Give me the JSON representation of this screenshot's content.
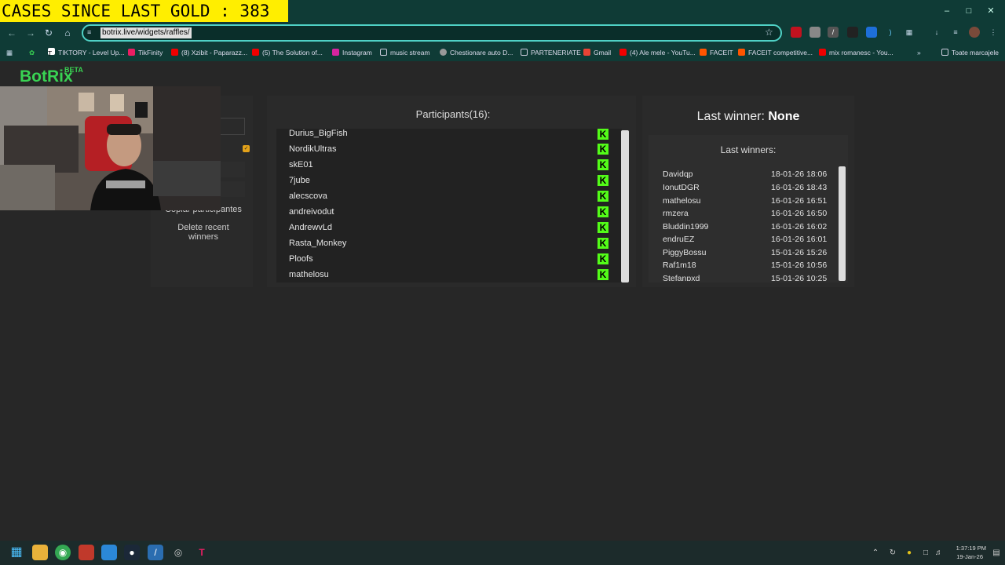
{
  "overlay": {
    "banner": "CASES SINCE LAST GOLD : 383"
  },
  "browser": {
    "url": "botrix.live/widgets/raffles/",
    "bookmarks": [
      "TIKTORY - Level Up...",
      "TikFinity",
      "(8) Xzibit - Paparazz...",
      "(5) The Solution of...",
      "Instagram",
      "music stream",
      "Chestionare auto D...",
      "PARTENERIATE",
      "Gmail",
      "(4) Ale mele - YouTu...",
      "FACEIT",
      "FACEIT competitive...",
      "mix romanesc - You...",
      "Toate marcajele"
    ]
  },
  "app": {
    "logo": "BotRix",
    "logo_badge": "BETA",
    "left_panel": {
      "copy_button": "Copiar participantes",
      "delete_button": "Delete recent winners"
    },
    "participants": {
      "title": "Participants(16):",
      "items": [
        "Durius_BigFish",
        "NordikUltras",
        "skE01",
        "7jube",
        "alecscova",
        "andreivodut",
        "AndrewvLd",
        "Rasta_Monkey",
        "Ploofs",
        "mathelosu"
      ]
    },
    "winner": {
      "label": "Last winner:",
      "value": "None",
      "history_title": "Last winners:",
      "history": [
        {
          "name": "Davidqp",
          "date": "18-01-26 18:06"
        },
        {
          "name": "IonutDGR",
          "date": "16-01-26 18:43"
        },
        {
          "name": "mathelosu",
          "date": "16-01-26 16:51"
        },
        {
          "name": "rmzera",
          "date": "16-01-26 16:50"
        },
        {
          "name": "Bluddin1999",
          "date": "16-01-26 16:02"
        },
        {
          "name": "endruEZ",
          "date": "16-01-26 16:01"
        },
        {
          "name": "PiggyBossu",
          "date": "15-01-26 15:26"
        },
        {
          "name": "Raf1m18",
          "date": "15-01-26 10:56"
        },
        {
          "name": "Stefanpxd",
          "date": "15-01-26 10:25"
        }
      ]
    }
  },
  "taskbar": {
    "time": "1:37:19 PM",
    "date": "19-Jan-26"
  },
  "colors": {
    "accent": "#39d353",
    "kick": "#53fc18",
    "chrome": "#0f3b36",
    "banner": "#ffee00"
  }
}
